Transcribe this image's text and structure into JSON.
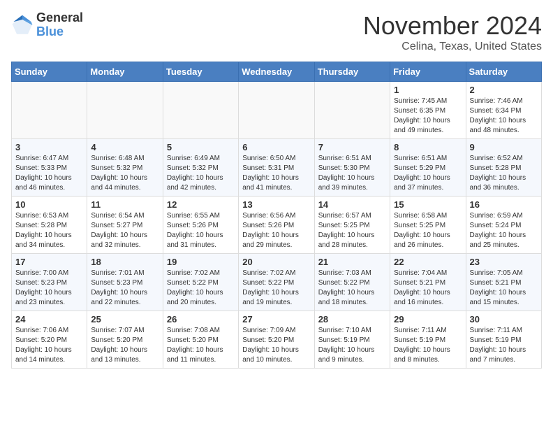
{
  "header": {
    "logo_general": "General",
    "logo_blue": "Blue",
    "month_title": "November 2024",
    "location": "Celina, Texas, United States"
  },
  "days_of_week": [
    "Sunday",
    "Monday",
    "Tuesday",
    "Wednesday",
    "Thursday",
    "Friday",
    "Saturday"
  ],
  "weeks": [
    [
      {
        "day": "",
        "info": ""
      },
      {
        "day": "",
        "info": ""
      },
      {
        "day": "",
        "info": ""
      },
      {
        "day": "",
        "info": ""
      },
      {
        "day": "",
        "info": ""
      },
      {
        "day": "1",
        "info": "Sunrise: 7:45 AM\nSunset: 6:35 PM\nDaylight: 10 hours\nand 49 minutes."
      },
      {
        "day": "2",
        "info": "Sunrise: 7:46 AM\nSunset: 6:34 PM\nDaylight: 10 hours\nand 48 minutes."
      }
    ],
    [
      {
        "day": "3",
        "info": "Sunrise: 6:47 AM\nSunset: 5:33 PM\nDaylight: 10 hours\nand 46 minutes."
      },
      {
        "day": "4",
        "info": "Sunrise: 6:48 AM\nSunset: 5:32 PM\nDaylight: 10 hours\nand 44 minutes."
      },
      {
        "day": "5",
        "info": "Sunrise: 6:49 AM\nSunset: 5:32 PM\nDaylight: 10 hours\nand 42 minutes."
      },
      {
        "day": "6",
        "info": "Sunrise: 6:50 AM\nSunset: 5:31 PM\nDaylight: 10 hours\nand 41 minutes."
      },
      {
        "day": "7",
        "info": "Sunrise: 6:51 AM\nSunset: 5:30 PM\nDaylight: 10 hours\nand 39 minutes."
      },
      {
        "day": "8",
        "info": "Sunrise: 6:51 AM\nSunset: 5:29 PM\nDaylight: 10 hours\nand 37 minutes."
      },
      {
        "day": "9",
        "info": "Sunrise: 6:52 AM\nSunset: 5:28 PM\nDaylight: 10 hours\nand 36 minutes."
      }
    ],
    [
      {
        "day": "10",
        "info": "Sunrise: 6:53 AM\nSunset: 5:28 PM\nDaylight: 10 hours\nand 34 minutes."
      },
      {
        "day": "11",
        "info": "Sunrise: 6:54 AM\nSunset: 5:27 PM\nDaylight: 10 hours\nand 32 minutes."
      },
      {
        "day": "12",
        "info": "Sunrise: 6:55 AM\nSunset: 5:26 PM\nDaylight: 10 hours\nand 31 minutes."
      },
      {
        "day": "13",
        "info": "Sunrise: 6:56 AM\nSunset: 5:26 PM\nDaylight: 10 hours\nand 29 minutes."
      },
      {
        "day": "14",
        "info": "Sunrise: 6:57 AM\nSunset: 5:25 PM\nDaylight: 10 hours\nand 28 minutes."
      },
      {
        "day": "15",
        "info": "Sunrise: 6:58 AM\nSunset: 5:25 PM\nDaylight: 10 hours\nand 26 minutes."
      },
      {
        "day": "16",
        "info": "Sunrise: 6:59 AM\nSunset: 5:24 PM\nDaylight: 10 hours\nand 25 minutes."
      }
    ],
    [
      {
        "day": "17",
        "info": "Sunrise: 7:00 AM\nSunset: 5:23 PM\nDaylight: 10 hours\nand 23 minutes."
      },
      {
        "day": "18",
        "info": "Sunrise: 7:01 AM\nSunset: 5:23 PM\nDaylight: 10 hours\nand 22 minutes."
      },
      {
        "day": "19",
        "info": "Sunrise: 7:02 AM\nSunset: 5:22 PM\nDaylight: 10 hours\nand 20 minutes."
      },
      {
        "day": "20",
        "info": "Sunrise: 7:02 AM\nSunset: 5:22 PM\nDaylight: 10 hours\nand 19 minutes."
      },
      {
        "day": "21",
        "info": "Sunrise: 7:03 AM\nSunset: 5:22 PM\nDaylight: 10 hours\nand 18 minutes."
      },
      {
        "day": "22",
        "info": "Sunrise: 7:04 AM\nSunset: 5:21 PM\nDaylight: 10 hours\nand 16 minutes."
      },
      {
        "day": "23",
        "info": "Sunrise: 7:05 AM\nSunset: 5:21 PM\nDaylight: 10 hours\nand 15 minutes."
      }
    ],
    [
      {
        "day": "24",
        "info": "Sunrise: 7:06 AM\nSunset: 5:20 PM\nDaylight: 10 hours\nand 14 minutes."
      },
      {
        "day": "25",
        "info": "Sunrise: 7:07 AM\nSunset: 5:20 PM\nDaylight: 10 hours\nand 13 minutes."
      },
      {
        "day": "26",
        "info": "Sunrise: 7:08 AM\nSunset: 5:20 PM\nDaylight: 10 hours\nand 11 minutes."
      },
      {
        "day": "27",
        "info": "Sunrise: 7:09 AM\nSunset: 5:20 PM\nDaylight: 10 hours\nand 10 minutes."
      },
      {
        "day": "28",
        "info": "Sunrise: 7:10 AM\nSunset: 5:19 PM\nDaylight: 10 hours\nand 9 minutes."
      },
      {
        "day": "29",
        "info": "Sunrise: 7:11 AM\nSunset: 5:19 PM\nDaylight: 10 hours\nand 8 minutes."
      },
      {
        "day": "30",
        "info": "Sunrise: 7:11 AM\nSunset: 5:19 PM\nDaylight: 10 hours\nand 7 minutes."
      }
    ]
  ]
}
